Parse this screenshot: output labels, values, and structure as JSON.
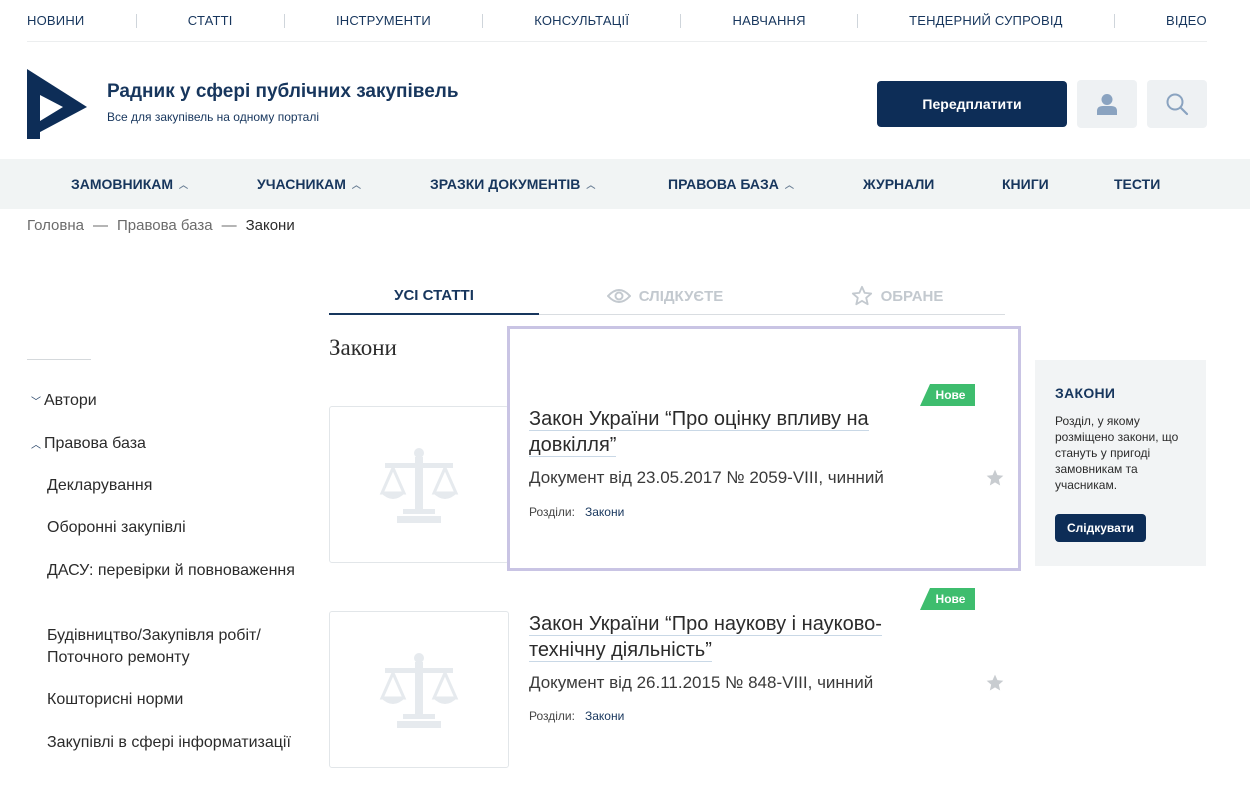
{
  "top_nav": [
    "НОВИНИ",
    "СТАТТІ",
    "ІНСТРУМЕНТИ",
    "КОНСУЛЬТАЦІЇ",
    "НАВЧАННЯ",
    "ТЕНДЕРНИЙ СУПРОВІД",
    "ВІДЕО"
  ],
  "header": {
    "title": "Радник у сфері публічних закупівель",
    "subtitle": "Все для закупівель на одному порталі",
    "subscribe_label": "Передплатити",
    "user_icon": "user-icon",
    "search_icon": "search-icon"
  },
  "main_nav": [
    {
      "label": "ЗАМОВНИКАМ",
      "has_chevron": true
    },
    {
      "label": "УЧАСНИКАМ",
      "has_chevron": true
    },
    {
      "label": "ЗРАЗКИ ДОКУМЕНТІВ",
      "has_chevron": true
    },
    {
      "label": "ПРАВОВА БАЗА",
      "has_chevron": true
    },
    {
      "label": "ЖУРНАЛИ",
      "has_chevron": false
    },
    {
      "label": "КНИГИ",
      "has_chevron": false
    },
    {
      "label": "ТЕСТИ",
      "has_chevron": false
    }
  ],
  "breadcrumb": [
    "Головна",
    "Правова база",
    "Закони"
  ],
  "breadcrumb_separator": "—",
  "tabs": [
    {
      "label": "УСІ СТАТТІ",
      "active": true
    },
    {
      "label": "СЛІДКУЄТЕ",
      "active": false,
      "icon": "eye-icon"
    },
    {
      "label": "ОБРАНЕ",
      "active": false,
      "icon": "star-outline-icon"
    }
  ],
  "section_title": "Закони",
  "sidebar": {
    "top_items": [
      {
        "label": "Автори",
        "expanded": false
      },
      {
        "label": "Правова база",
        "expanded": true
      }
    ],
    "sub_items": [
      "Декларування",
      "Оборонні закупівлі",
      "ДАСУ: перевірки й повноваження",
      "Будівництво/Закупівля робіт/ Поточного ремонту",
      "Кошторисні норми",
      "Закупівлі в сфері інформатизації"
    ]
  },
  "articles": [
    {
      "badge": "Нове",
      "title": "Закон України “Про оцінку впливу на довкілля”",
      "meta": "Документ від 23.05.2017 № 2059-VIII, чинний",
      "sections_label": "Розділи:",
      "section_link": "Закони",
      "thumb_icon": "scales-icon"
    },
    {
      "badge": "Нове",
      "title": "Закон України “Про наукову і науково-технічну діяльність”",
      "meta": "Документ від 26.11.2015 № 848-VIII, чинний",
      "sections_label": "Розділи:",
      "section_link": "Закони",
      "thumb_icon": "scales-icon"
    }
  ],
  "info_box": {
    "title": "ЗАКОНИ",
    "text": "Розділ, у якому розміщено закони, що стануть у пригоді замовникам та учасникам.",
    "button_label": "Слідкувати"
  },
  "colors": {
    "brand_navy": "#0d2d57",
    "link_navy": "#17365d",
    "badge_green": "#3ebd6e",
    "highlight_border": "#c9c4e4",
    "nav_bg": "#f1f4f4"
  }
}
